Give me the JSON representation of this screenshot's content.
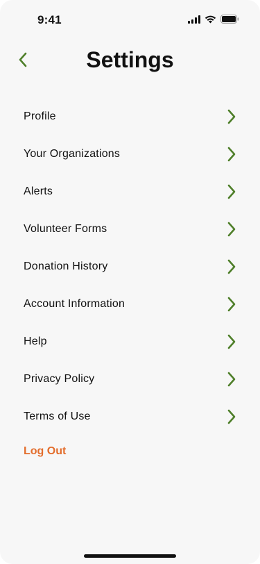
{
  "status_bar": {
    "time": "9:41",
    "icons": [
      "signal-icon",
      "wifi-icon",
      "battery-icon"
    ]
  },
  "header": {
    "title": "Settings",
    "back_icon": "chevron-left-icon"
  },
  "menu": {
    "items": [
      {
        "label": "Profile"
      },
      {
        "label": "Your Organizations"
      },
      {
        "label": "Alerts"
      },
      {
        "label": "Volunteer Forms"
      },
      {
        "label": "Donation History"
      },
      {
        "label": "Account Information"
      },
      {
        "label": "Help"
      },
      {
        "label": "Privacy Policy"
      },
      {
        "label": "Terms of Use"
      }
    ],
    "item_icon": "chevron-right-icon"
  },
  "logout": {
    "label": "Log Out"
  },
  "colors": {
    "accent": "#4f7f2a",
    "logout": "#e36d2c",
    "background": "#f7f7f7",
    "text": "#111111"
  }
}
